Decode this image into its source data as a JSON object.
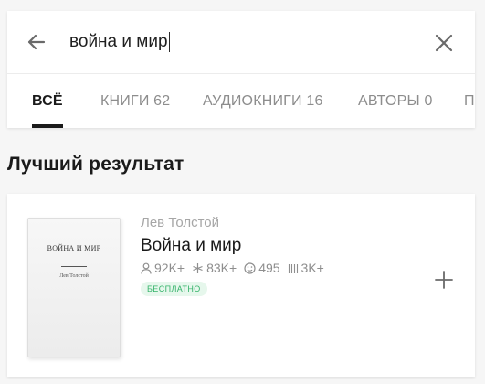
{
  "search": {
    "query": "война и мир",
    "back_icon": "arrow-left-icon",
    "clear_icon": "close-icon"
  },
  "tabs": [
    {
      "label": "ВСЁ",
      "active": true
    },
    {
      "label": "КНИГИ 62",
      "active": false
    },
    {
      "label": "АУДИОКНИГИ 16",
      "active": false
    },
    {
      "label": "АВТОРЫ 0",
      "active": false
    },
    {
      "label": "ПО",
      "active": false
    }
  ],
  "section": {
    "title": "Лучший результат"
  },
  "result": {
    "cover_title": "ВОЙНА И МИР",
    "cover_author": "Лев Толстой",
    "author": "Лев Толстой",
    "title": "Война и мир",
    "stats": {
      "readers": "92K+",
      "rating": "83K+",
      "reactions": "495",
      "quotes": "3K+"
    },
    "badge": "БЕСПЛАТНО",
    "add_icon": "plus-icon"
  },
  "colors": {
    "accent_green": "#35b36a",
    "badge_bg": "#e6f7ec",
    "text_primary": "#1a1a1a",
    "text_muted": "#8e8e8e",
    "background": "#f6f6f6"
  }
}
